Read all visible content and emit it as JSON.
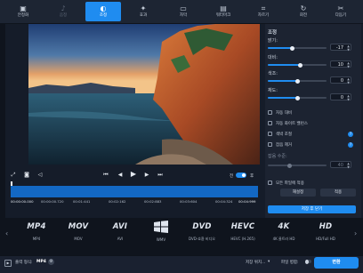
{
  "toolbar": {
    "items": [
      {
        "label": "안정화",
        "icon": "stabilize-icon"
      },
      {
        "label": "음정",
        "icon": "music-note-icon"
      },
      {
        "label": "조정",
        "icon": "adjust-icon"
      },
      {
        "label": "효과",
        "icon": "magic-wand-icon"
      },
      {
        "label": "자막",
        "icon": "subtitle-icon"
      },
      {
        "label": "워터마크",
        "icon": "watermark-icon"
      },
      {
        "label": "자르기",
        "icon": "crop-icon"
      },
      {
        "label": "회전",
        "icon": "rotate-icon"
      },
      {
        "label": "다듬기",
        "icon": "trim-icon"
      }
    ]
  },
  "panel": {
    "title": "조정",
    "sliders": [
      {
        "label": "밝기:",
        "value": "-17",
        "level_pct": 42
      },
      {
        "label": "대비:",
        "value": "10",
        "level_pct": 55
      },
      {
        "label": "색조:",
        "value": "0",
        "level_pct": 50
      },
      {
        "label": "채도:",
        "value": "0",
        "level_pct": 50
      }
    ],
    "checkboxes": [
      {
        "label": "자동 대비",
        "help": false
      },
      {
        "label": "자동 화이트 밸런스",
        "help": false
      },
      {
        "label": "색박 조절",
        "help": true
      },
      {
        "label": "잡음 제거",
        "help": true
      }
    ],
    "noise_label": "잡음 수준:",
    "noise_value": "40",
    "apply_all_label": "모든 파일에 적용",
    "reset_label": "재설정",
    "apply_label": "적용",
    "save_close_label": "저장 후 닫기"
  },
  "playback": {
    "toggle_before": "전",
    "toggle_after": "후"
  },
  "timeline": {
    "timecodes": [
      "00:00:00.000",
      "00:00:00.720",
      "00:01:441",
      "00:02:162",
      "00:02:883",
      "00:03:604",
      "00:04:324",
      "00:04:999"
    ]
  },
  "formats": [
    {
      "logo": "MP4",
      "name": "MP4"
    },
    {
      "logo": "MOV",
      "name": "MOV"
    },
    {
      "logo": "AVI",
      "name": "AVI"
    },
    {
      "logo": "",
      "name": "WMV"
    },
    {
      "logo": "DVD",
      "name": "DVD-호환 비디오"
    },
    {
      "logo": "HEVC",
      "name": "HEVC (H.265)"
    },
    {
      "logo": "4K",
      "name": "4K 울트라 HD"
    },
    {
      "logo": "HD",
      "name": "HD/Full HD"
    }
  ],
  "bottom": {
    "output_label": "출력 형식:",
    "output_value": "MP4",
    "save_to_label": "저장 위치...",
    "file_merge_label": "파일 병합:",
    "convert_label": "변환"
  },
  "colors": {
    "accent": "#1f8cf0",
    "background": "#151c29",
    "timeline": "#1368c4"
  }
}
